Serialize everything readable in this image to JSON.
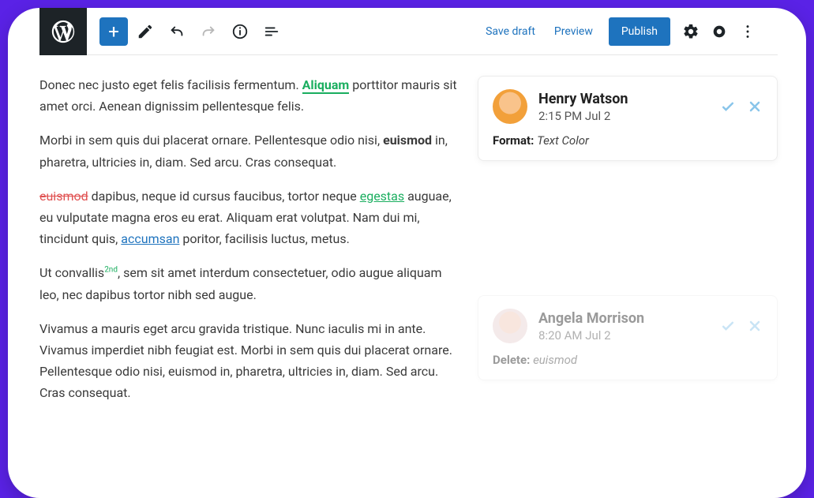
{
  "toolbar": {
    "save_draft": "Save draft",
    "preview": "Preview",
    "publish": "Publish"
  },
  "editor": {
    "p1_a": "Donec nec justo eget felis facilisis fermentum. ",
    "p1_mark": "Aliquam",
    "p1_b": " porttitor mauris sit amet orci. Aenean dignissim pellentesque felis.",
    "p2_a": "Morbi in sem quis dui placerat ornare. Pellentesque odio nisi, ",
    "p2_bold": "euismod",
    "p2_b": " in, pharetra, ultricies in, diam. Sed arcu. Cras consequat.",
    "p3_strike": "euismod",
    "p3_a": " dapibus, neque id cursus faucibus, tortor neque ",
    "p3_link1": "egestas",
    "p3_b": " auguae, eu vulputate magna eros eu erat. Aliquam erat volutpat. Nam dui mi, tincidunt quis, ",
    "p3_link2": "accumsan",
    "p3_c": " poritor, facilisis luctus, metus.",
    "p4_a": "Ut convallis",
    "p4_sup": "2nd",
    "p4_b": ", sem sit amet interdum consectetuer, odio augue aliquam leo, nec dapibus tortor nibh sed augue.",
    "p5": "Vivamus a mauris eget arcu gravida tristique. Nunc iaculis mi in ante. Vivamus imperdiet nibh feugiat est. Morbi in sem quis dui placerat ornare. Pellentesque odio nisi, euismod in, pharetra, ultricies in, diam. Sed arcu. Cras consequat."
  },
  "comments": [
    {
      "user": "Henry Watson",
      "time": "2:15 PM Jul 2",
      "label": "Format:",
      "value": "Text Color"
    },
    {
      "user": "Angela Morrison",
      "time": "8:20 AM Jul 2",
      "label": "Delete:",
      "value": "euismod"
    }
  ],
  "colors": {
    "accent_blue": "#1e73be",
    "accent_green": "#1aae5f",
    "check_blue": "#9fcbe8",
    "close_blue": "#9fcbe8"
  }
}
